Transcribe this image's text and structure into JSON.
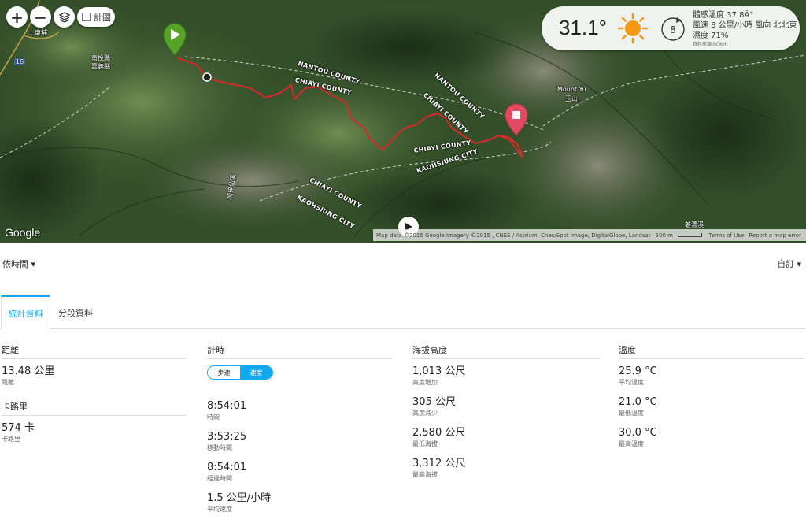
{
  "map": {
    "zoom_in": "+",
    "zoom_out": "−",
    "legend_label": "計圖",
    "counties": [
      "NANTOU COUNTY",
      "CHIAYI COUNTY",
      "NANTOU COUNTY",
      "CHIAYI COUNTY",
      "CHIAYI COUNTY",
      "KAOHSIUNG CITY",
      "CHIAYI COUNTY",
      "KAOHSIUNG CITY"
    ],
    "places": [
      "上東埔",
      "南投縣",
      "嘉義縣",
      "Mount Yu",
      "玉山",
      "荖濃溪",
      "楠梓仙溪",
      "18"
    ],
    "google": "Google",
    "attribution": "Map data ©2015 Google Imagery ©2015 , CNES / Astrium, Cnes/Spot Image, DigitalGlobe, Landsat",
    "scale": "500 m",
    "terms": "Terms of Use",
    "report": "Report a map error"
  },
  "weather": {
    "temperature": "31.1°",
    "wind_speed_badge": "8",
    "feels_like": "體感溫度 37.8Â°",
    "wind": "風速 8 公里/小時 風向 北北東",
    "humidity": "濕度 71%",
    "source": "資料來源:RCKH"
  },
  "toolbar": {
    "view_by": "依時間 ▾",
    "custom": "自訂 ▾"
  },
  "tabs": {
    "stats": "統計資料",
    "splits": "分段資料"
  },
  "stats": {
    "distance": {
      "heading": "距離",
      "value": "13.48 公里",
      "label": "距離",
      "cal_heading": "卡路里",
      "cal_value": "574 卡",
      "cal_label": "卡路里"
    },
    "timing": {
      "heading": "計時",
      "pace_btn": "步速",
      "speed_btn": "速度",
      "items": [
        {
          "value": "8:54:01",
          "label": "時間"
        },
        {
          "value": "3:53:25",
          "label": "移動時間"
        },
        {
          "value": "8:54:01",
          "label": "經過時間"
        },
        {
          "value": "1.5 公里/小時",
          "label": "平均速度"
        }
      ]
    },
    "elevation": {
      "heading": "海拔高度",
      "items": [
        {
          "value": "1,013 公尺",
          "label": "高度增加"
        },
        {
          "value": "305 公尺",
          "label": "高度減少"
        },
        {
          "value": "2,580 公尺",
          "label": "最低海拔"
        },
        {
          "value": "3,312 公尺",
          "label": "最高海拔"
        }
      ]
    },
    "temperature": {
      "heading": "溫度",
      "items": [
        {
          "value": "25.9 °C",
          "label": "平均溫度"
        },
        {
          "value": "21.0 °C",
          "label": "最低溫度"
        },
        {
          "value": "30.0 °C",
          "label": "最高溫度"
        }
      ]
    }
  },
  "colors": {
    "accent": "#11a9ed",
    "track": "#d42a2a",
    "start_pin": "#57a32a",
    "end_pin": "#e24a62"
  }
}
